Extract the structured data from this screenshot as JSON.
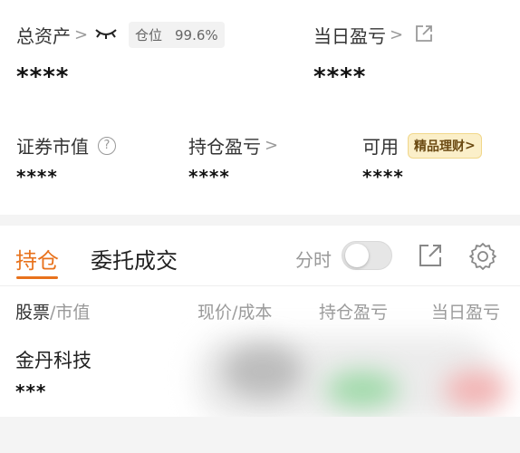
{
  "summary": {
    "total_assets_label": "总资产",
    "position_label": "仓位",
    "position_value": "99.6%",
    "total_assets_value": "****",
    "daily_pl_label": "当日盈亏",
    "daily_pl_value": "****",
    "market_value_label": "证券市值",
    "market_value_value": "****",
    "holding_pl_label": "持仓盈亏",
    "holding_pl_value": "****",
    "available_label": "可用",
    "available_value": "****",
    "promo_label": "精品理财",
    "chevron": ">",
    "help_glyph": "?"
  },
  "tabs": {
    "holdings": "持仓",
    "orders": "委托成交"
  },
  "toolbar": {
    "intraday_label": "分时"
  },
  "table": {
    "headers": {
      "stock": "股票",
      "market_value": "/市值",
      "price_cost": "现价/成本",
      "holding_pl": "持仓盈亏",
      "daily_pl": "当日盈亏"
    },
    "rows": [
      {
        "name": "金丹科技",
        "value": "***"
      }
    ]
  },
  "colors": {
    "accent": "#e8721c",
    "promo_bg": "#fbefc9",
    "green_blur": "#9ed9a8",
    "red_blur": "#f3b0b0"
  },
  "icons": {
    "eye": "eye-closed-icon",
    "external": "external-link-icon",
    "help": "help-circle-icon",
    "settings": "gear-icon"
  }
}
